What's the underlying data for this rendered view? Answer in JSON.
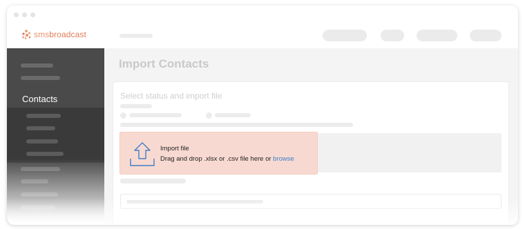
{
  "brand": {
    "name_part1": "sms",
    "name_part2": "broadcast",
    "accent_color": "#e8916a"
  },
  "sidebar": {
    "active_item_label": "Contacts",
    "colors": {
      "background": "#4a4a4a",
      "submenu": "#3a3a3a"
    }
  },
  "main": {
    "page_title": "Import Contacts",
    "card_title": "Select status and import file",
    "import": {
      "title": "Import file",
      "description": "Drag and drop .xlsx or .csv file here or ",
      "browse_label": "browse",
      "link_color": "#3f7ec7",
      "highlight_color": "#f8d9d1"
    }
  },
  "icons": {
    "logo": "logo-icon",
    "upload": "upload-arrow-icon"
  }
}
